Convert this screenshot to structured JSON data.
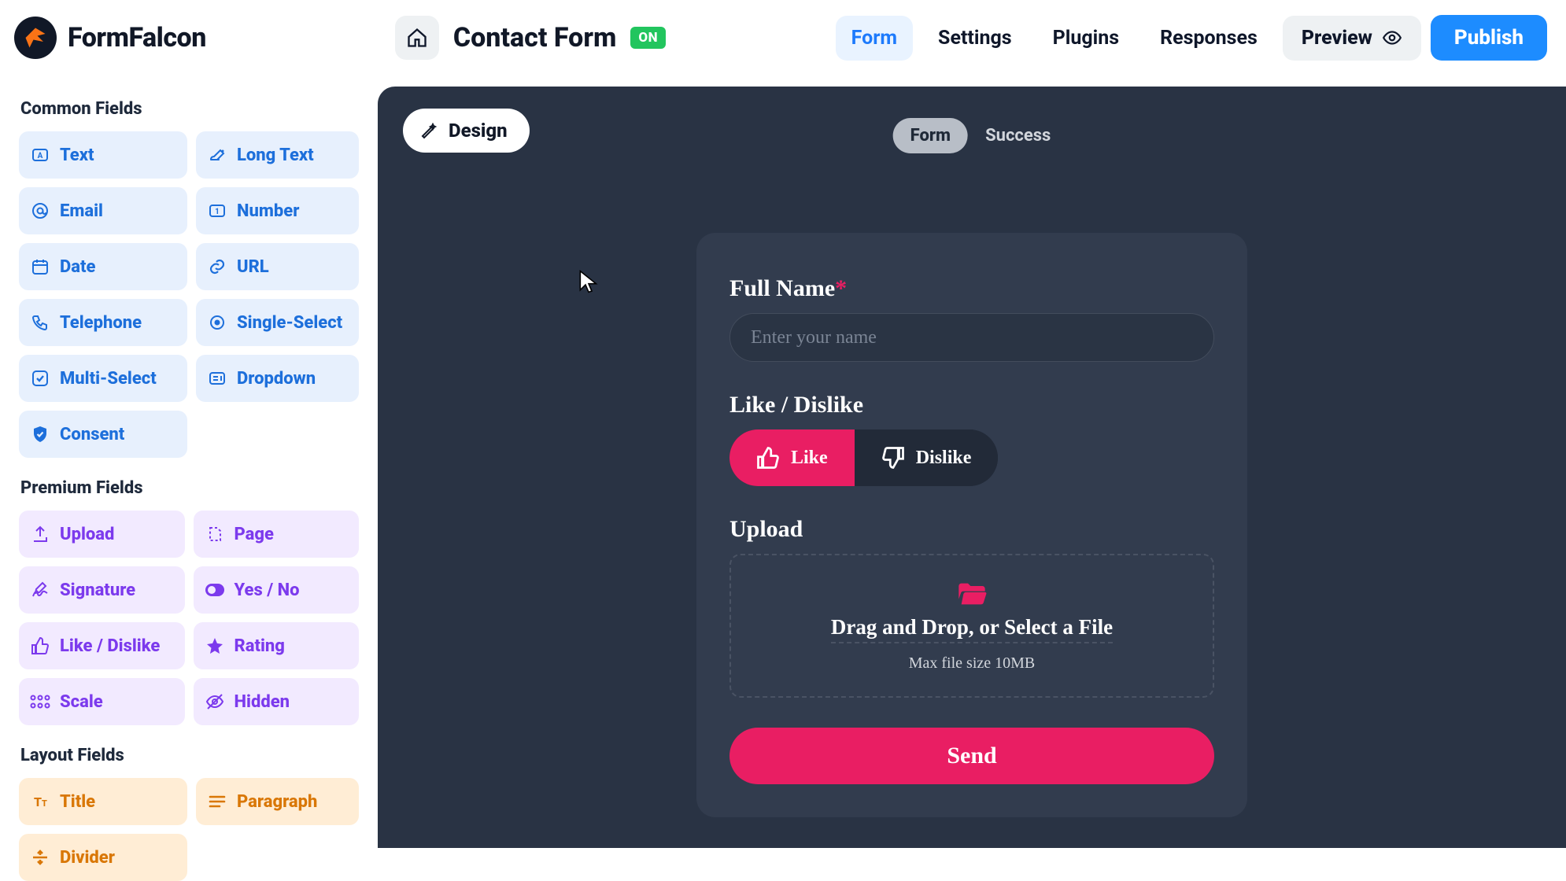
{
  "app": {
    "name": "FormFalcon"
  },
  "header": {
    "formTitle": "Contact Form",
    "status": "ON",
    "tabs": [
      "Form",
      "Settings",
      "Plugins",
      "Responses"
    ],
    "activeTab": 0,
    "preview": "Preview",
    "publish": "Publish"
  },
  "sidebar": {
    "commonHeading": "Common Fields",
    "common": [
      {
        "label": "Text",
        "icon": "text"
      },
      {
        "label": "Long Text",
        "icon": "longtext"
      },
      {
        "label": "Email",
        "icon": "email"
      },
      {
        "label": "Number",
        "icon": "number"
      },
      {
        "label": "Date",
        "icon": "date"
      },
      {
        "label": "URL",
        "icon": "url"
      },
      {
        "label": "Telephone",
        "icon": "phone"
      },
      {
        "label": "Single-Select",
        "icon": "radio"
      },
      {
        "label": "Multi-Select",
        "icon": "checkbox"
      },
      {
        "label": "Dropdown",
        "icon": "dropdown"
      },
      {
        "label": "Consent",
        "icon": "shield"
      }
    ],
    "premiumHeading": "Premium Fields",
    "premium": [
      {
        "label": "Upload",
        "icon": "upload"
      },
      {
        "label": "Page",
        "icon": "page"
      },
      {
        "label": "Signature",
        "icon": "signature"
      },
      {
        "label": "Yes / No",
        "icon": "toggle"
      },
      {
        "label": "Like / Dislike",
        "icon": "thumb"
      },
      {
        "label": "Rating",
        "icon": "star"
      },
      {
        "label": "Scale",
        "icon": "scale"
      },
      {
        "label": "Hidden",
        "icon": "hidden"
      }
    ],
    "layoutHeading": "Layout Fields",
    "layout": [
      {
        "label": "Title",
        "icon": "title"
      },
      {
        "label": "Paragraph",
        "icon": "paragraph"
      },
      {
        "label": "Divider",
        "icon": "divider"
      }
    ]
  },
  "canvas": {
    "designBtn": "Design",
    "viewForm": "Form",
    "viewSuccess": "Success"
  },
  "form": {
    "fullName": {
      "label": "Full Name",
      "placeholder": "Enter your name"
    },
    "likeDislike": {
      "label": "Like / Dislike",
      "like": "Like",
      "dislike": "Dislike"
    },
    "upload": {
      "label": "Upload",
      "line1": "Drag and Drop, or Select a File",
      "line2": "Max file size 10MB"
    },
    "submit": "Send"
  }
}
